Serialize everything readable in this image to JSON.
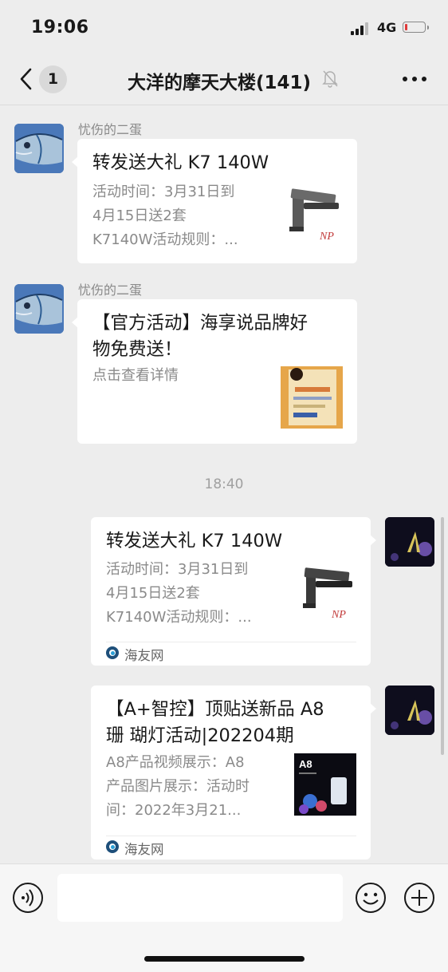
{
  "status_bar": {
    "time": "19:06",
    "network": "4G",
    "battery_level": 0.1
  },
  "nav": {
    "unread_count": "1",
    "title": "大洋的摩天大楼(141)"
  },
  "messages": [
    {
      "sender": "忧伤的二蛋",
      "title": "转发送大礼 K7 140W",
      "desc": "活动时间：3月31日到\n4月15日送2套\nK7140W活动规则：..."
    },
    {
      "sender": "忧伤的二蛋",
      "title": "【官方活动】海享说品牌好\n物免费送！",
      "desc": "点击查看详情"
    },
    {
      "title": "转发送大礼 K7 140W",
      "desc": "活动时间：3月31日到\n4月15日送2套\nK7140W活动规则：...",
      "source": "海友网"
    },
    {
      "title": "【A+智控】顶贴送新品 A8\n珊 瑚灯活动|202204期",
      "desc": "A8产品视频展示：A8\n产品图片展示：活动时\n间：2022年3月21...",
      "source": "海友网",
      "thumb_label": "A8"
    }
  ],
  "timestamp": "18:40",
  "thumb_logo": "NP",
  "colors": {
    "background": "#ededed",
    "card": "#ffffff",
    "muted_text": "#8a8a8a"
  }
}
